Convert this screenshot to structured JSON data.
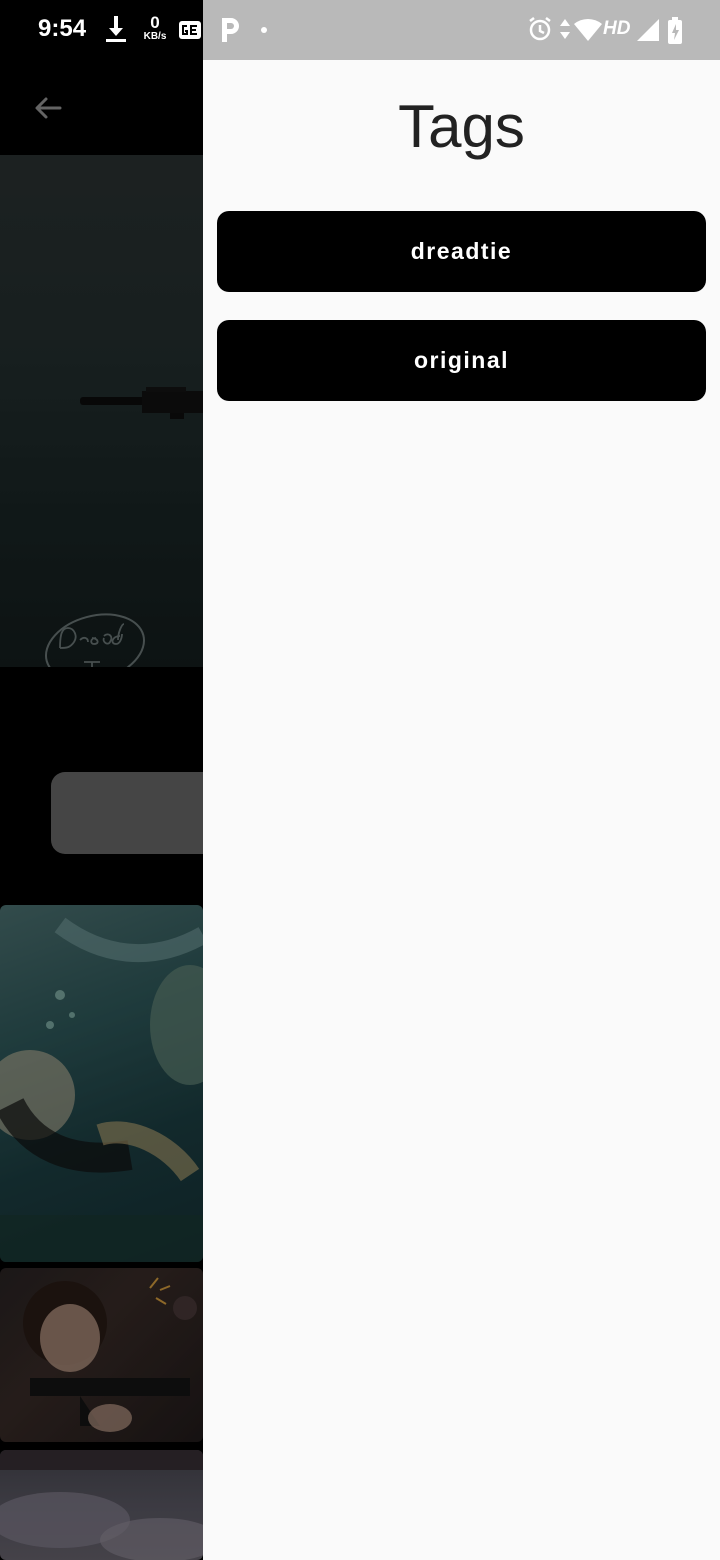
{
  "status_bar": {
    "time": "9:54",
    "net_speed_value": "0",
    "net_speed_unit": "KB/s",
    "network_label": "HD",
    "icons": [
      "download-icon",
      "ge-app-icon",
      "p-app-icon",
      "notification-dot-icon",
      "alarm-icon",
      "data-arrows-icon",
      "wifi-icon",
      "signal-icon",
      "battery-charging-icon"
    ]
  },
  "background_app": {
    "nav_icon": "back-arrow-icon",
    "signature_text": "Dread Tie"
  },
  "drawer": {
    "title": "Tags",
    "tags": [
      {
        "label": "dreadtie"
      },
      {
        "label": "original"
      }
    ]
  },
  "colors": {
    "drawer_background": "#fafafa",
    "tag_button": "#000000",
    "tag_text": "#ffffff",
    "status_bar_right": "#b9b9b9"
  }
}
